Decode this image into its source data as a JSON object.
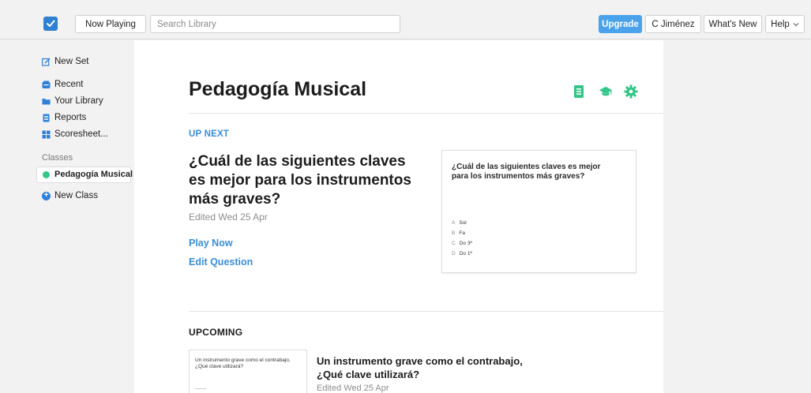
{
  "header": {
    "now_playing_label": "Now Playing",
    "search_placeholder": "Search Library",
    "upgrade_label": "Upgrade",
    "user_label": "C Jiménez",
    "whats_new_label": "What's New",
    "help_label": "Help"
  },
  "sidebar": {
    "new_set": "New Set",
    "recent": "Recent",
    "library": "Your Library",
    "reports": "Reports",
    "scoresheet": "Scoresheet...",
    "classes_heading": "Classes",
    "active_class": "Pedagogía Musical",
    "new_class": "New Class"
  },
  "main": {
    "title": "Pedagogía Musical",
    "up_next_label": "UP NEXT",
    "question": "¿Cuál de las siguientes claves es mejor para los instrumentos más graves?",
    "edited": "Edited Wed 25 Apr",
    "play_now": "Play Now",
    "edit_question": "Edit Question",
    "preview": {
      "question": "¿Cuál de las siguientes claves es mejor para los instrumentos más graves?",
      "options": [
        {
          "letter": "A",
          "text": "Sol"
        },
        {
          "letter": "B",
          "text": "Fa"
        },
        {
          "letter": "C",
          "text": "Do 3ª"
        },
        {
          "letter": "D",
          "text": "Do 1ª"
        }
      ]
    },
    "upcoming_label": "UPCOMING",
    "upcoming_item": {
      "thumb_text": "Un instrumento grave como el contrabajo, ¿Qué clave utilizará?",
      "title": "Un instrumento grave como el contrabajo, ¿Qué clave utilizará?",
      "edited": "Edited Wed 25 Apr"
    }
  },
  "colors": {
    "accent_blue": "#3a8ed6",
    "upgrade_blue": "#4aa3ea",
    "green": "#34c587"
  }
}
